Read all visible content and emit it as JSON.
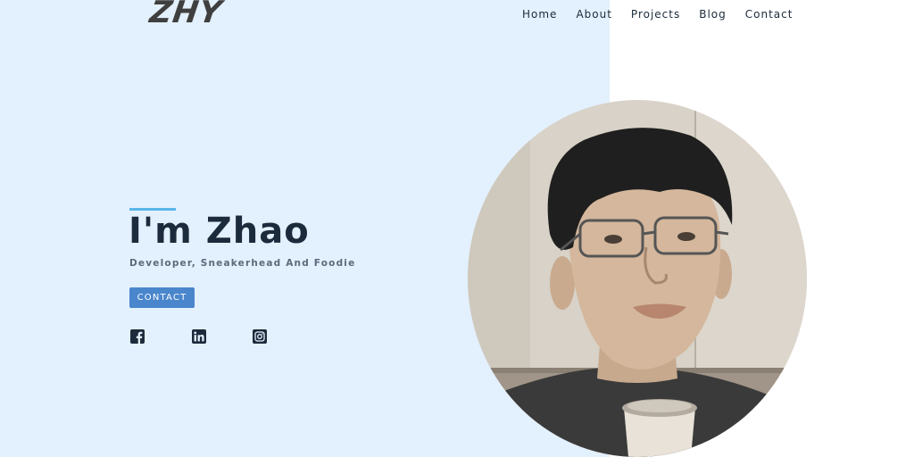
{
  "header": {
    "logo_text": "ZHY",
    "nav": [
      {
        "label": "Home"
      },
      {
        "label": "About"
      },
      {
        "label": "Projects"
      },
      {
        "label": "Blog"
      },
      {
        "label": "Contact"
      }
    ]
  },
  "hero": {
    "title": "I'm Zhao",
    "subtitle": "Developer, Sneakerhead And Foodie",
    "cta_label": "CONTACT",
    "accent_color": "#5ab6ea",
    "button_color": "#4a86cc",
    "background_color": "#e3f0fd"
  },
  "social": [
    {
      "icon": "facebook-icon"
    },
    {
      "icon": "linkedin-icon"
    },
    {
      "icon": "instagram-icon"
    }
  ],
  "portrait": {
    "icon": "profile-photo"
  }
}
